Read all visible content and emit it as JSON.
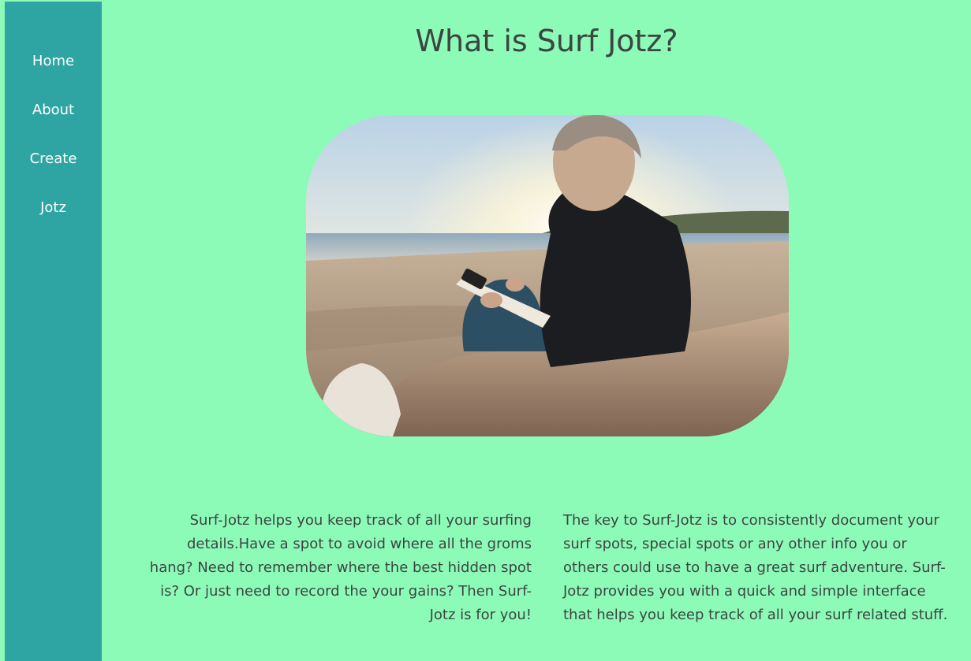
{
  "nav": {
    "items": [
      {
        "label": "Home"
      },
      {
        "label": "About"
      },
      {
        "label": "Create"
      },
      {
        "label": "Jotz"
      }
    ]
  },
  "main": {
    "title": "What is Surf Jotz?",
    "paragraph_left": "Surf-Jotz helps you keep track of all your surfing details.Have a spot to avoid where all the groms hang? Need to remember where the best hidden spot is? Or just need to record the your gains? Then Surf-Jotz is for you!",
    "paragraph_right": "The key to Surf-Jotz is to consistently document your surf spots, special spots or any other info you or others could use to have a great surf adventure. Surf-Jotz provides you with a quick and simple interface that helps you keep track of all your surf related stuff."
  },
  "colors": {
    "background": "#8dfbb8",
    "sidebar": "#2fa5a3",
    "text": "#3c4540",
    "nav_text": "#ffffff"
  }
}
